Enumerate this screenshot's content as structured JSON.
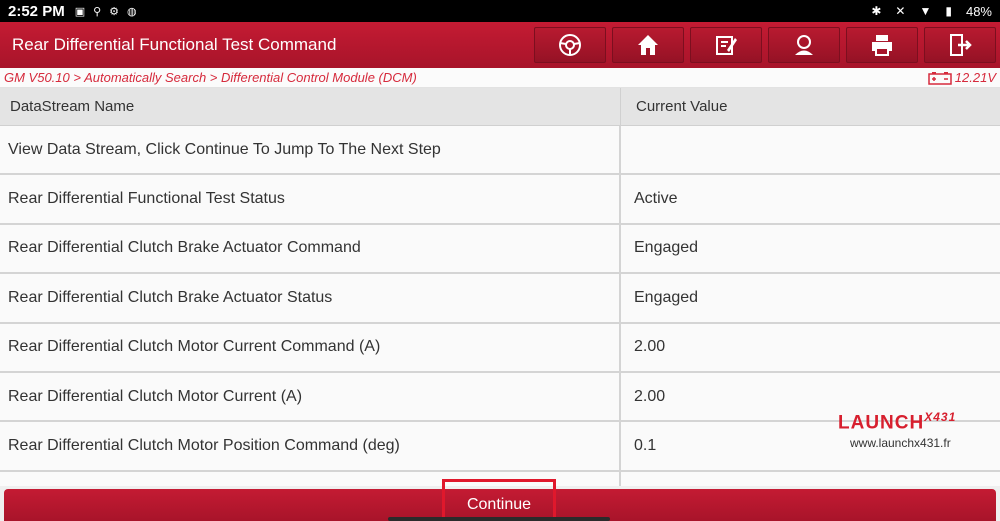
{
  "status_bar": {
    "time": "2:52 PM",
    "battery": "48%"
  },
  "titlebar": {
    "title": "Rear Differential Functional Test Command"
  },
  "breadcrumb": {
    "path": "GM V50.10 > Automatically Search > Differential Control Module (DCM)",
    "voltage": "12.21V"
  },
  "table": {
    "headers": {
      "name": "DataStream Name",
      "value": "Current Value"
    },
    "rows": [
      {
        "name": "View Data Stream, Click Continue To Jump To The Next Step",
        "value": ""
      },
      {
        "name": "Rear Differential Functional Test Status",
        "value": "Active"
      },
      {
        "name": "Rear Differential Clutch Brake Actuator Command",
        "value": "Engaged"
      },
      {
        "name": "Rear Differential Clutch Brake Actuator Status",
        "value": "Engaged"
      },
      {
        "name": "Rear Differential Clutch Motor Current Command (A)",
        "value": "2.00"
      },
      {
        "name": "Rear Differential Clutch Motor Current (A)",
        "value": "2.00"
      },
      {
        "name": "Rear Differential Clutch Motor Position Command (deg)",
        "value": "0.1"
      },
      {
        "name": "",
        "value": ""
      }
    ]
  },
  "watermark": {
    "brand": "LAUNCH",
    "model": "X431",
    "url": "www.launchx431.fr"
  },
  "footer": {
    "continue_label": "Continue"
  },
  "colors": {
    "brand_red": "#c41b33",
    "accent_text": "#d62a3c"
  }
}
